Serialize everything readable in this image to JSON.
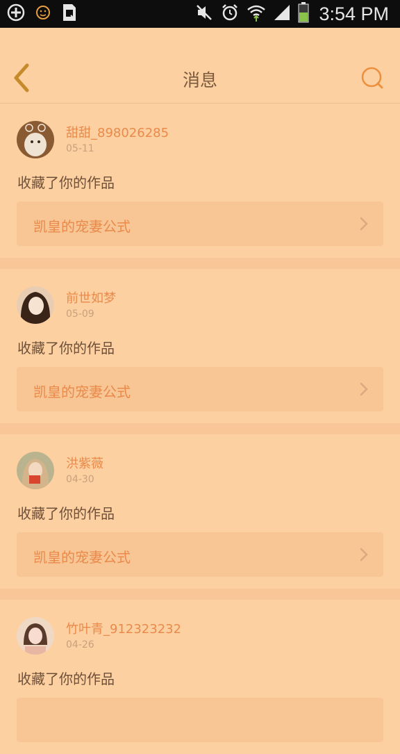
{
  "status_bar": {
    "time": "3:54 PM",
    "icons": [
      "add-circle-icon",
      "emoji-icon",
      "sim-card-icon",
      "mute-icon",
      "alarm-icon",
      "wifi-icon",
      "signal-icon",
      "battery-icon"
    ]
  },
  "header": {
    "title": "消息",
    "back_icon": "chevron-left-icon",
    "search_icon": "search-icon"
  },
  "colors": {
    "background": "#fdd0a2",
    "accent": "#e98a4a",
    "text": "#6e5038",
    "card_box": "#f8c595"
  },
  "messages": [
    {
      "username": "甜甜_898026285",
      "date": "05-11",
      "action": "收藏了你的作品",
      "work_title": "凯皇的宠妻公式"
    },
    {
      "username": "前世如梦",
      "date": "05-09",
      "action": "收藏了你的作品",
      "work_title": "凯皇的宠妻公式"
    },
    {
      "username": "洪紫薇",
      "date": "04-30",
      "action": "收藏了你的作品",
      "work_title": "凯皇的宠妻公式"
    },
    {
      "username": "竹叶青_912323232",
      "date": "04-26",
      "action": "收藏了你的作品",
      "work_title": ""
    }
  ]
}
